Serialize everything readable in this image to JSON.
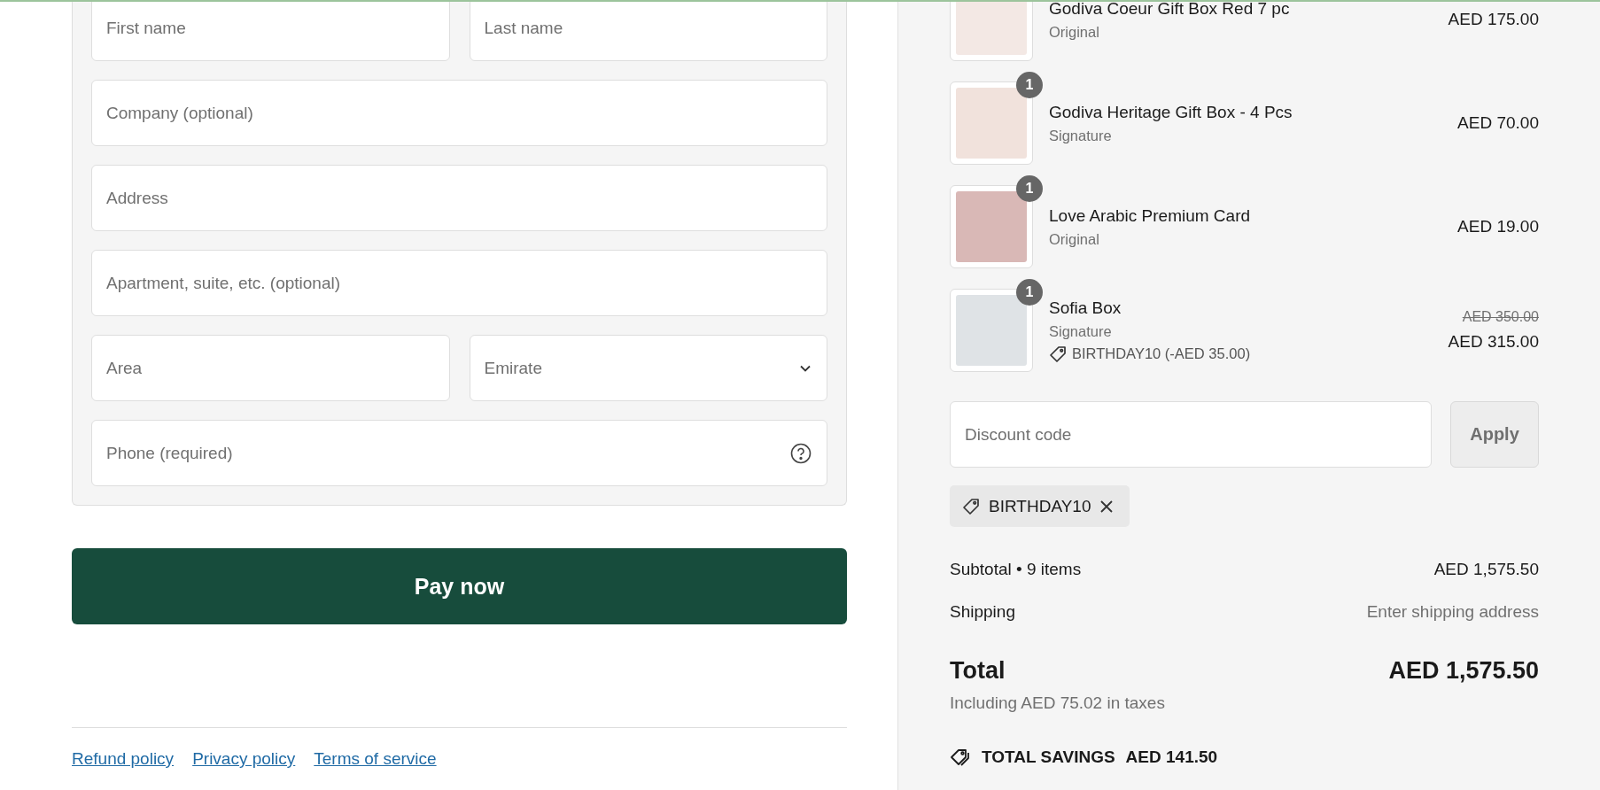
{
  "form": {
    "rows": [
      [
        {
          "kind": "text",
          "placeholder": "First name"
        },
        {
          "kind": "text",
          "placeholder": "Last name"
        }
      ],
      [
        {
          "kind": "text",
          "placeholder": "Company (optional)"
        }
      ],
      [
        {
          "kind": "text",
          "placeholder": "Address"
        }
      ],
      [
        {
          "kind": "text",
          "placeholder": "Apartment, suite, etc. (optional)"
        }
      ],
      [
        {
          "kind": "text",
          "placeholder": "Area"
        },
        {
          "kind": "select",
          "placeholder": "Emirate"
        }
      ],
      [
        {
          "kind": "help",
          "placeholder": "Phone (required)"
        }
      ]
    ]
  },
  "pay_button": "Pay now",
  "footer_links": [
    "Refund policy",
    "Privacy policy",
    "Terms of service"
  ],
  "summary": {
    "items": [
      {
        "name": "Godiva Coeur Gift Box Red 7 pc",
        "variant": "Original",
        "price": "AED 175.00"
      },
      {
        "name": "Godiva Heritage Gift Box - 4 Pcs",
        "variant": "Signature",
        "price": "AED 70.00",
        "quantity": "1"
      },
      {
        "name": "Love Arabic Premium Card",
        "variant": "Original",
        "price": "AED 19.00",
        "quantity": "1"
      },
      {
        "name": "Sofia Box",
        "variant": "Signature",
        "price": "AED 315.00",
        "quantity": "1",
        "original_price": "AED 350.00",
        "discount": "BIRTHDAY10 (-AED 35.00)"
      }
    ],
    "discount_field": {
      "placeholder": "Discount code"
    },
    "apply_button": "Apply",
    "applied_codes": [
      "BIRTHDAY10"
    ],
    "subtotal": {
      "label": "Subtotal • 9 items",
      "value": "AED 1,575.50"
    },
    "shipping": {
      "label": "Shipping",
      "value": "Enter shipping address"
    },
    "total": {
      "label": "Total",
      "value": "AED 1,575.50"
    },
    "taxes_note": "Including AED 75.02 in taxes",
    "savings": {
      "label": "TOTAL SAVINGS",
      "value": "AED 141.50"
    }
  }
}
